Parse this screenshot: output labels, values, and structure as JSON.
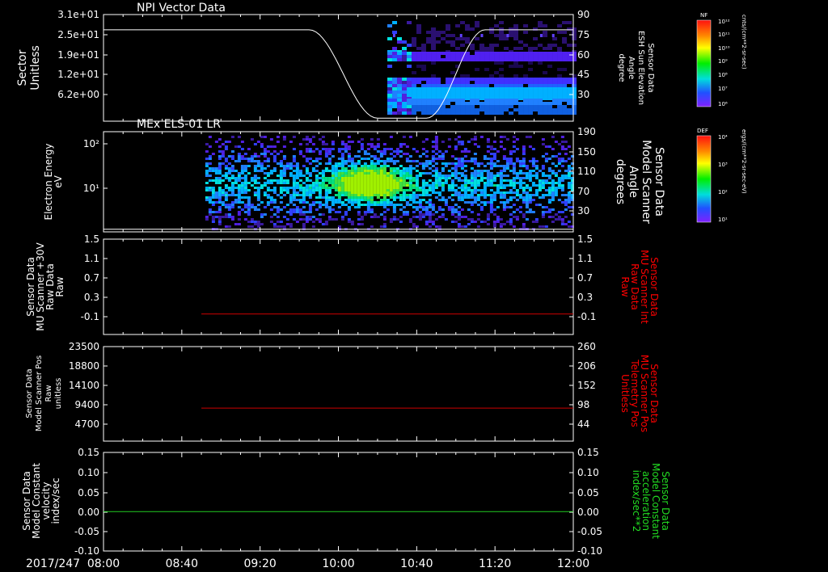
{
  "chart_data": [
    {
      "type": "heatmap",
      "title": "NPI Vector Data",
      "left_axis": {
        "label_lines": [
          "Sector",
          "Unitless"
        ],
        "ticks": [
          "3.1e+01",
          "2.5e+01",
          "1.9e+01",
          "1.2e+01",
          "6.2e+00"
        ]
      },
      "right_axis": {
        "label_lines": [
          "Sensor Data",
          "ESH Sun Elevation",
          "Angle",
          "degree"
        ],
        "ticks": [
          "90",
          "75",
          "60",
          "45",
          "30"
        ],
        "range": [
          20,
          90
        ]
      },
      "line": {
        "color": "#ffffff",
        "points": [
          [
            0,
            80
          ],
          [
            105,
            80
          ],
          [
            140,
            22
          ],
          [
            165,
            22
          ],
          [
            195,
            80
          ],
          [
            240,
            80
          ]
        ]
      },
      "colorbar": {
        "name": "NF",
        "unit": "cnts/(cm**2-sr-sec)",
        "ticks": [
          "10¹²",
          "10¹¹",
          "10¹⁰",
          "10⁹",
          "10⁸",
          "10⁷",
          "10⁶"
        ]
      }
    },
    {
      "type": "heatmap",
      "title": "MEx ELS-01 LR",
      "left_axis": {
        "label_lines": [
          "Electron Energy",
          "eV"
        ],
        "ticks": [
          "10²",
          "10¹"
        ],
        "scale": "log"
      },
      "right_axis": {
        "label_lines": [
          "Sensor Data",
          "Model Scanner",
          "Angle",
          "degrees"
        ],
        "ticks": [
          "190",
          "150",
          "110",
          "70",
          "30"
        ],
        "range": [
          0,
          190
        ]
      },
      "line": {
        "color": "#ffffff",
        "points": [
          [
            0,
            5
          ],
          [
            240,
            5
          ]
        ]
      },
      "colorbar": {
        "name": "DEF",
        "unit": "ergs/(cm**2-sr-sec-eV)",
        "ticks": [
          "10⁴",
          "10³",
          "10²",
          "10¹"
        ]
      }
    },
    {
      "type": "line",
      "left_axis": {
        "label_lines": [
          "Sensor Data",
          "MU Scanner +30V",
          "Raw Data",
          "Raw"
        ],
        "ticks": [
          "1.5",
          "1.1",
          "0.7",
          "0.3",
          "-0.1"
        ],
        "range": [
          -0.5,
          1.5
        ]
      },
      "right_axis": {
        "label_lines": [
          "Sensor Data",
          "MU Scanner Int",
          "Raw Data",
          "Raw"
        ],
        "ticks": [
          "1.5",
          "1.1",
          "0.7",
          "0.3",
          "-0.1"
        ],
        "color": "#ff0000"
      },
      "series": [
        {
          "color": "#cc0000",
          "x": [
            50,
            240
          ],
          "y": [
            -0.07,
            -0.07
          ]
        }
      ]
    },
    {
      "type": "line",
      "left_axis": {
        "label_lines": [
          "Sensor Data",
          "Model Scanner Pos",
          "Raw",
          "unitless"
        ],
        "ticks": [
          "23500",
          "18800",
          "14100",
          "9400",
          "4700"
        ],
        "range": [
          0,
          23500
        ]
      },
      "right_axis": {
        "label_lines": [
          "Sensor Data",
          "MU Scanner Pos",
          "Telemetry Pos",
          "Unitless"
        ],
        "ticks": [
          "260",
          "206",
          "152",
          "98",
          "44"
        ],
        "color": "#ff0000"
      },
      "series": [
        {
          "color": "#cc0000",
          "x": [
            50,
            240
          ],
          "y": [
            8200,
            8200
          ]
        }
      ]
    },
    {
      "type": "line",
      "left_axis": {
        "label_lines": [
          "Sensor Data",
          "Model Constant",
          "velocity",
          "index/sec"
        ],
        "ticks": [
          "0.15",
          "0.10",
          "0.05",
          "0.00",
          "-0.05",
          "-0.10"
        ],
        "range": [
          -0.1,
          0.15
        ]
      },
      "right_axis": {
        "label_lines": [
          "Sensor Data",
          "Model Constant",
          "acceleration",
          "index/sec**2"
        ],
        "ticks": [
          "0.15",
          "0.10",
          "0.05",
          "0.00",
          "-0.05",
          "-0.10"
        ],
        "color": "#22dd22"
      },
      "series": [
        {
          "color": "#22cc22",
          "x": [
            0,
            240
          ],
          "y": [
            0,
            0
          ]
        }
      ]
    }
  ],
  "time_axis": {
    "date": "2017/247",
    "labels": [
      "08:00",
      "08:40",
      "09:20",
      "10:00",
      "10:40",
      "11:20",
      "12:00"
    ],
    "range_minutes": [
      0,
      240
    ]
  }
}
